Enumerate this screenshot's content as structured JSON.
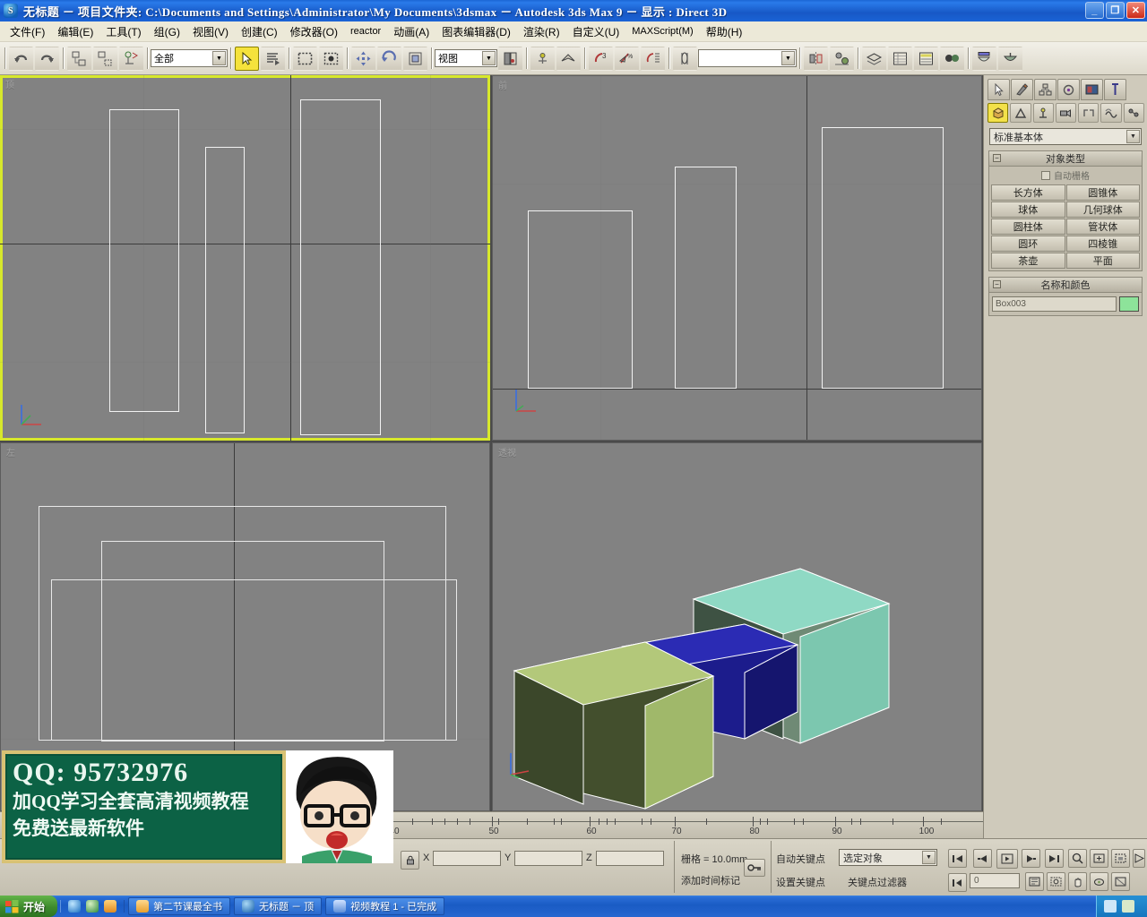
{
  "window": {
    "app_icon": "3dsmax-icon",
    "title": "无标题      － 项目文件夹: C:\\Documents and Settings\\Administrator\\My Documents\\3dsmax      － Autodesk 3ds Max 9      － 显示 : Direct 3D",
    "minimize": "_",
    "maximize": "❐",
    "close": "✕"
  },
  "menubar": [
    {
      "label": "文件(F)"
    },
    {
      "label": "编辑(E)"
    },
    {
      "label": "工具(T)"
    },
    {
      "label": "组(G)"
    },
    {
      "label": "视图(V)"
    },
    {
      "label": "创建(C)"
    },
    {
      "label": "修改器(O)"
    },
    {
      "label": "reactor"
    },
    {
      "label": "动画(A)"
    },
    {
      "label": "图表编辑器(D)"
    },
    {
      "label": "渲染(R)"
    },
    {
      "label": "自定义(U)"
    },
    {
      "label": "MAXScript(M)"
    },
    {
      "label": "帮助(H)"
    }
  ],
  "toolbar": {
    "undo": "撤消",
    "redo": "重做",
    "select_link": "选择并链接",
    "unlink": "断开选择链接",
    "bind_spacewarp": "绑定到空间扭曲",
    "selection_filter_value": "全部",
    "select_object": "选择对象",
    "select_by_name": "按名称选择",
    "rect_select_region": "矩形选择区域",
    "window_crossing": "窗口/交叉",
    "select_move": "选择并移动",
    "select_rotate": "选择并旋转",
    "select_scale": "选择并均匀缩放",
    "reference_coord_value": "视图",
    "use_pivot_center": "使用轴点中心",
    "snap_toggle": "捕捉开关",
    "angle_snap": "角度捕捉切换",
    "percent_snap": "百分比捕捉切换",
    "spinner_snap": "微调器捕捉切换",
    "named_selection_sets": "命名选择集",
    "named_selection_value": "",
    "mirror": "镜像",
    "align": "对齐",
    "layer_manager": "层管理器",
    "curve_editor": "曲线编辑器",
    "schematic_view": "图解视图",
    "material_editor": "材质编辑器",
    "render_setup": "渲染设置",
    "render_production": "渲染产品"
  },
  "viewports": [
    {
      "name": "top",
      "label": "顶",
      "active": true
    },
    {
      "name": "front",
      "label": "前",
      "active": false
    },
    {
      "name": "left",
      "label": "左",
      "active": false
    },
    {
      "name": "perspective",
      "label": "透视",
      "active": false
    }
  ],
  "command_panel": {
    "tabs": [
      {
        "name": "create",
        "icon": "arrow-create-icon",
        "selected": false
      },
      {
        "name": "modify",
        "icon": "modify-icon",
        "selected": false
      },
      {
        "name": "hierarchy",
        "icon": "hierarchy-icon",
        "selected": false
      },
      {
        "name": "motion",
        "icon": "motion-icon",
        "selected": false
      },
      {
        "name": "display",
        "icon": "display-icon",
        "selected": false
      },
      {
        "name": "utilities",
        "icon": "utilities-icon",
        "selected": false
      }
    ],
    "category_icons": [
      {
        "name": "geometry",
        "icon": "box-icon",
        "selected": true
      },
      {
        "name": "shapes",
        "icon": "shape-icon",
        "selected": false
      },
      {
        "name": "lights",
        "icon": "light-icon",
        "selected": false
      },
      {
        "name": "cameras",
        "icon": "camera-icon",
        "selected": false
      },
      {
        "name": "helpers",
        "icon": "helper-icon",
        "selected": false
      },
      {
        "name": "spacewarps",
        "icon": "spacewarp-icon",
        "selected": false
      },
      {
        "name": "systems",
        "icon": "systems-icon",
        "selected": false
      }
    ],
    "subcategory_value": "标准基本体",
    "object_type_rollout": "对象类型",
    "autogrid_label": "自动栅格",
    "object_buttons": [
      "长方体",
      "圆锥体",
      "球体",
      "几何球体",
      "圆柱体",
      "管状体",
      "圆环",
      "四棱锥",
      "茶壶",
      "平面"
    ],
    "name_color_rollout": "名称和颜色",
    "name_value": "Box003",
    "color_swatch": "#8de39a"
  },
  "timeline": {
    "ticks": [
      "40",
      "50",
      "60",
      "70",
      "80",
      "90",
      "100"
    ],
    "tick_values": [
      40,
      50,
      60,
      70,
      80,
      90,
      100
    ]
  },
  "statusbar": {
    "lock_selection": "选择锁定切换",
    "x_label": "X",
    "x_value": "",
    "y_label": "Y",
    "y_value": "",
    "z_label": "Z",
    "z_value": "",
    "grid_label": "栅格 = 10.0mm",
    "time_tag": "添加时间标记",
    "key_mode": "关键点模式",
    "auto_key": "自动关键点",
    "set_key": "设置关键点",
    "key_filter_value": "选定对象",
    "key_filters": "关键点过滤器",
    "frame_value": "0",
    "nav_icons": [
      "zoom-icon",
      "zoom-all-icon",
      "zoom-extents-icon",
      "zoom-region-icon",
      "pan-icon",
      "arc-rotate-icon",
      "maximize-viewport-icon"
    ]
  },
  "ad_overlay": {
    "line1": "QQ: 95732976",
    "line2": "加QQ学习全套高清视频教程",
    "line3": "免费送最新软件"
  },
  "taskbar": {
    "start_label": "开始",
    "quick_launch": [
      "ie-icon",
      "media-icon",
      "folder-icon"
    ],
    "items": [
      {
        "icon": "folder-icon",
        "label": "第二节课最全书"
      },
      {
        "icon": "3dsmax-icon",
        "label": "无标题     － 顶"
      },
      {
        "icon": "video-icon",
        "label": "视频教程 1 - 已完成"
      }
    ],
    "tray_time": ""
  },
  "scene": {
    "boxes": [
      {
        "name": "box-back",
        "color": "#8fd9c4"
      },
      {
        "name": "box-middle",
        "color": "#1c1c8c"
      },
      {
        "name": "box-front",
        "color": "#b3c87a"
      }
    ]
  }
}
